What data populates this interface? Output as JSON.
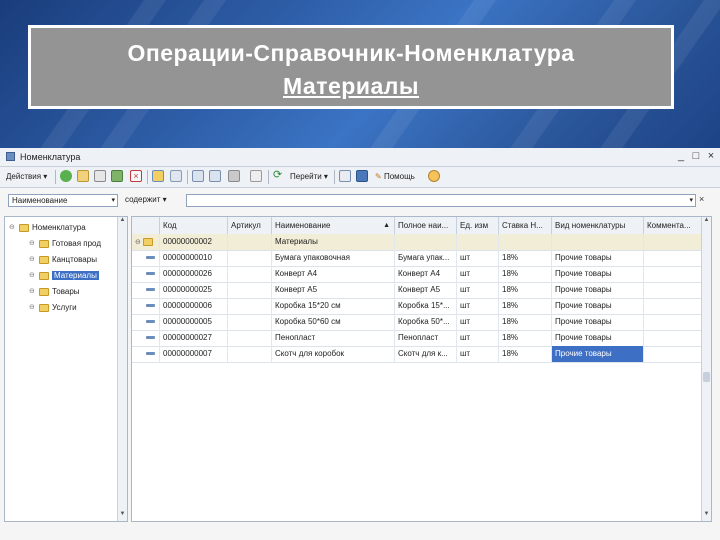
{
  "slide": {
    "title_line1": "Операции-Справочник-Номенклатура",
    "title_line2": "Материалы"
  },
  "window": {
    "title": "Номенклатура",
    "controls": [
      "_",
      "□",
      "×"
    ]
  },
  "toolbar": {
    "actions_label": "Действия",
    "goto_label": "Перейти",
    "help_label": "Помощь",
    "icons": [
      "add-icon",
      "copy-icon",
      "add-group-icon",
      "edit-icon",
      "delete-icon",
      "hierarchy-icon",
      "list-icon",
      "filter-icon",
      "filter-settings-icon",
      "clear-filter-icon",
      "refresh-icon",
      "list-settings-icon",
      "report-icon",
      "help-icon"
    ]
  },
  "filter": {
    "field_value": "Наименование",
    "mode_value": "содержит",
    "search_value": ""
  },
  "tree": {
    "root": "Номенклатура",
    "items": [
      "Готовая прод",
      "Канцтовары",
      "Материалы",
      "Товары",
      "Услуги"
    ],
    "selected": "Материалы"
  },
  "grid": {
    "headers": {
      "code": "Код",
      "article": "Артикул",
      "name": "Наименование",
      "full_name": "Полное наи...",
      "unit": "Ед. изм",
      "vat": "Ставка Н...",
      "type": "Вид номенклатуры",
      "comment": "Коммента..."
    },
    "group_row": {
      "code": "00000000002",
      "name": "Материалы"
    },
    "rows": [
      {
        "code": "00000000010",
        "article": "",
        "name": "Бумага упаковочная",
        "full_name": "Бумага упак...",
        "unit": "шт",
        "vat": "18%",
        "type": "Прочие товары",
        "comment": ""
      },
      {
        "code": "00000000026",
        "article": "",
        "name": "Конверт А4",
        "full_name": "Конверт А4",
        "unit": "шт",
        "vat": "18%",
        "type": "Прочие товары",
        "comment": ""
      },
      {
        "code": "00000000025",
        "article": "",
        "name": "Конверт А5",
        "full_name": "Конверт А5",
        "unit": "шт",
        "vat": "18%",
        "type": "Прочие товары",
        "comment": ""
      },
      {
        "code": "00000000006",
        "article": "",
        "name": "Коробка 15*20 см",
        "full_name": "Коробка 15*...",
        "unit": "шт",
        "vat": "18%",
        "type": "Прочие товары",
        "comment": ""
      },
      {
        "code": "00000000005",
        "article": "",
        "name": "Коробка 50*60 см",
        "full_name": "Коробка 50*...",
        "unit": "шт",
        "vat": "18%",
        "type": "Прочие товары",
        "comment": ""
      },
      {
        "code": "00000000027",
        "article": "",
        "name": "Пенопласт",
        "full_name": "Пенопласт",
        "unit": "шт",
        "vat": "18%",
        "type": "Прочие товары",
        "comment": ""
      },
      {
        "code": "00000000007",
        "article": "",
        "name": "Скотч для коробок",
        "full_name": "Скотч для к...",
        "unit": "шт",
        "vat": "18%",
        "type": "Прочие товары",
        "comment": ""
      }
    ]
  }
}
